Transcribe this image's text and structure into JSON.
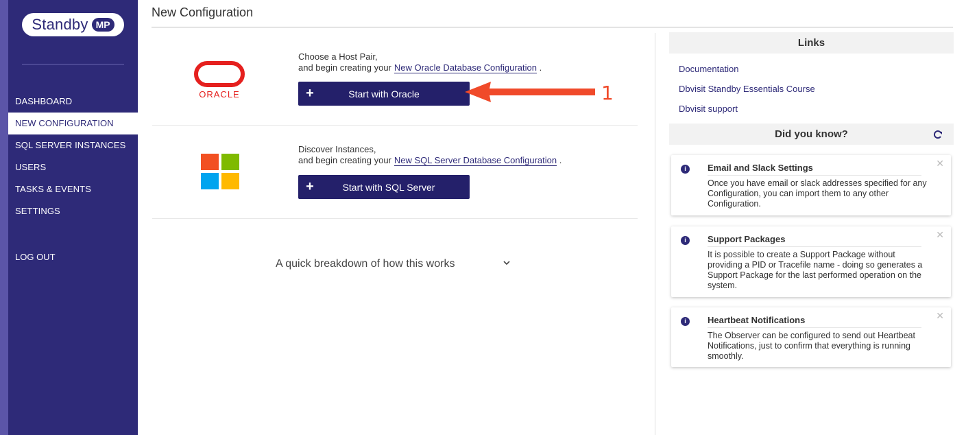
{
  "sidebar": {
    "logo_text": "Standby",
    "logo_badge": "MP",
    "items": [
      {
        "label": "DASHBOARD"
      },
      {
        "label": "NEW CONFIGURATION"
      },
      {
        "label": "SQL SERVER INSTANCES"
      },
      {
        "label": "USERS"
      },
      {
        "label": "TASKS & EVENTS"
      },
      {
        "label": "SETTINGS"
      }
    ],
    "logout": "LOG OUT",
    "active_index": 1
  },
  "page": {
    "title": "New Configuration"
  },
  "oracle": {
    "line1": "Choose a Host Pair,",
    "line2": "and begin creating your",
    "link": "New Oracle Database Configuration",
    "suffix": ".",
    "button": "Start with Oracle",
    "logo_text": "ORACLE"
  },
  "sqlserver": {
    "line1": "Discover Instances,",
    "line2": "and begin creating your",
    "link": "New SQL Server Database Configuration",
    "suffix": ".",
    "button": "Start with SQL Server"
  },
  "breakdown": {
    "label": "A quick breakdown of how this works"
  },
  "links": {
    "title": "Links",
    "items": [
      {
        "label": "Documentation"
      },
      {
        "label": "Dbvisit Standby Essentials Course"
      },
      {
        "label": "Dbvisit support"
      }
    ]
  },
  "did_you_know": {
    "title": "Did you know?",
    "cards": [
      {
        "title": "Email and Slack Settings",
        "body": "Once you have email or slack addresses specified for any Configuration, you can import them to any other Configuration."
      },
      {
        "title": "Support Packages",
        "body": "It is possible to create a Support Package without providing a PID or Tracefile name - doing so generates a Support Package for the last performed operation on the system."
      },
      {
        "title": "Heartbeat Notifications",
        "body": "The Observer can be configured to send out Heartbeat Notifications, just to confirm that everything is running smoothly."
      }
    ]
  },
  "annotation": {
    "label": "1"
  },
  "colors": {
    "sidebar": "#2e2a78",
    "button": "#24206a",
    "oracle_red": "#e5201e",
    "annotation": "#f04a2a"
  }
}
